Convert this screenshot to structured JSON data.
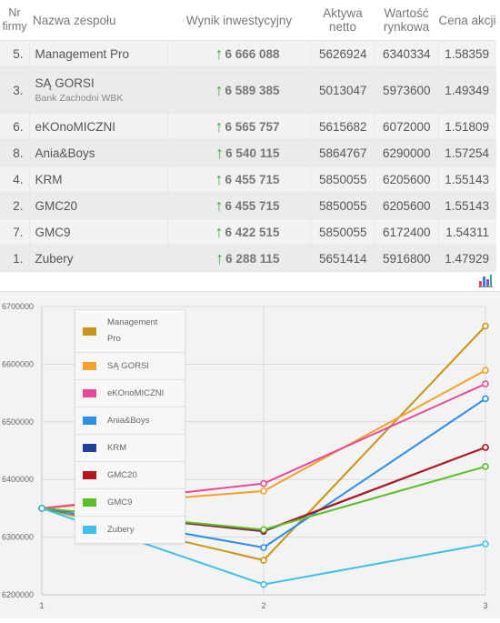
{
  "table": {
    "headers": {
      "nr": "Nr firmy",
      "name": "Nazwa zespołu",
      "score": "Wynik inwestycyjny",
      "assets": "Aktywa netto",
      "market": "Wartość rynkowa",
      "price": "Cena akcji"
    },
    "rows": [
      {
        "nr": "5.",
        "name": "Management Pro",
        "sub": "",
        "score": "6 666 088",
        "assets": "5626924",
        "market": "6340334",
        "price": "1.58359"
      },
      {
        "nr": "3.",
        "name": "SĄ GORSI",
        "sub": "Bank Zachodni WBK",
        "score": "6 589 385",
        "assets": "5013047",
        "market": "5973600",
        "price": "1.49349"
      },
      {
        "nr": "6.",
        "name": "eKOnoMICZNI",
        "sub": "",
        "score": "6 565 757",
        "assets": "5615682",
        "market": "6072000",
        "price": "1.51809"
      },
      {
        "nr": "8.",
        "name": "Ania&Boys",
        "sub": "",
        "score": "6 540 115",
        "assets": "5864767",
        "market": "6290000",
        "price": "1.57254"
      },
      {
        "nr": "4.",
        "name": "KRM",
        "sub": "",
        "score": "6 455 715",
        "assets": "5850055",
        "market": "6205600",
        "price": "1.55143"
      },
      {
        "nr": "2.",
        "name": "GMC20",
        "sub": "",
        "score": "6 455 715",
        "assets": "5850055",
        "market": "6205600",
        "price": "1.55143"
      },
      {
        "nr": "7.",
        "name": "GMC9",
        "sub": "",
        "score": "6 422 515",
        "assets": "5850055",
        "market": "6172400",
        "price": "1.54311"
      },
      {
        "nr": "1.",
        "name": "Zubery",
        "sub": "",
        "score": "6 288 115",
        "assets": "5651414",
        "market": "5916800",
        "price": "1.47929"
      }
    ],
    "trend_icon": "up-arrow-icon"
  },
  "toolbar": {
    "chart_icon": "bar-chart-icon"
  },
  "chart_data": {
    "type": "line",
    "x": [
      1,
      2,
      3
    ],
    "x_tick_labels": [
      "1",
      "2",
      "3"
    ],
    "ylim": [
      6200000,
      6700000
    ],
    "y_tick_labels": [
      "6700000",
      "6600000",
      "6500000",
      "6400000",
      "6300000",
      "6200000"
    ],
    "grid": true,
    "legend_position": "top-left",
    "series": [
      {
        "name": "Management Pro",
        "color": "#c9941a",
        "values": [
          6350000,
          6260000,
          6666088
        ]
      },
      {
        "name": "SĄ GORSI",
        "color": "#f4a12b",
        "values": [
          6350000,
          6380000,
          6589385
        ]
      },
      {
        "name": "eKOnoMICZNI",
        "color": "#e8489a",
        "values": [
          6350000,
          6393000,
          6565757
        ]
      },
      {
        "name": "Ania&Boys",
        "color": "#2c8ee8",
        "values": [
          6350000,
          6282000,
          6540115
        ]
      },
      {
        "name": "KRM",
        "color": "#1f3f9a",
        "values": [
          6350000,
          6310000,
          6455715
        ]
      },
      {
        "name": "GMC20",
        "color": "#b5161c",
        "values": [
          6350000,
          6311000,
          6455715
        ]
      },
      {
        "name": "GMC9",
        "color": "#5cbf2a",
        "values": [
          6350000,
          6313000,
          6422515
        ]
      },
      {
        "name": "Zubery",
        "color": "#3fc0e8",
        "values": [
          6350000,
          6218000,
          6288115
        ]
      }
    ]
  }
}
